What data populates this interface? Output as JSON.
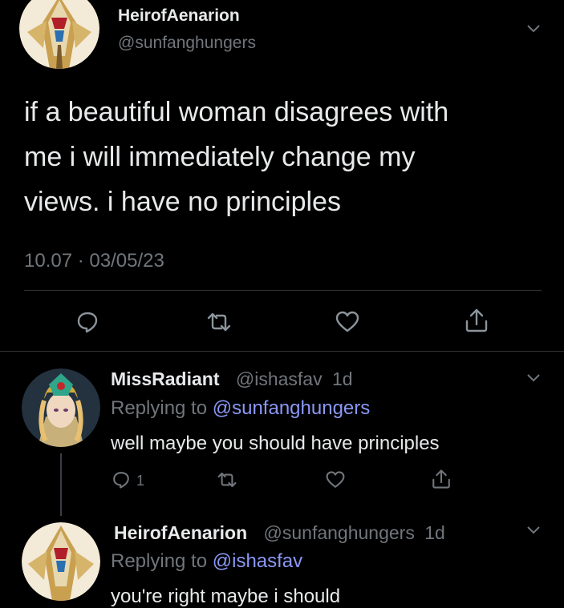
{
  "tweet": {
    "display_name": "HeirofAenarion",
    "handle": "@sunfanghungers",
    "text_lines": [
      "if a beautiful woman disagrees with",
      "me i will immediately change my",
      "views. i have no principles"
    ],
    "timestamp": "10.07 · 03/05/23"
  },
  "replies": [
    {
      "display_name": "MissRadiant",
      "handle": "@ishasfav",
      "age": "1d",
      "replying_label": "Replying to",
      "replying_to": "@sunfanghungers",
      "text": "well maybe you should have principles",
      "reply_count": "1"
    },
    {
      "display_name": "HeirofAenarion",
      "handle": "@sunfanghungers",
      "age": "1d",
      "replying_label": "Replying to",
      "replying_to": "@ishasfav",
      "text": "you're right maybe i should"
    }
  ],
  "icons": [
    "reply-icon",
    "retweet-icon",
    "like-icon",
    "share-icon",
    "chevron-down-icon"
  ],
  "colors": {
    "background": "#000000",
    "text": "#e7e9ea",
    "muted": "#71767b",
    "mention": "#8b98f5"
  }
}
